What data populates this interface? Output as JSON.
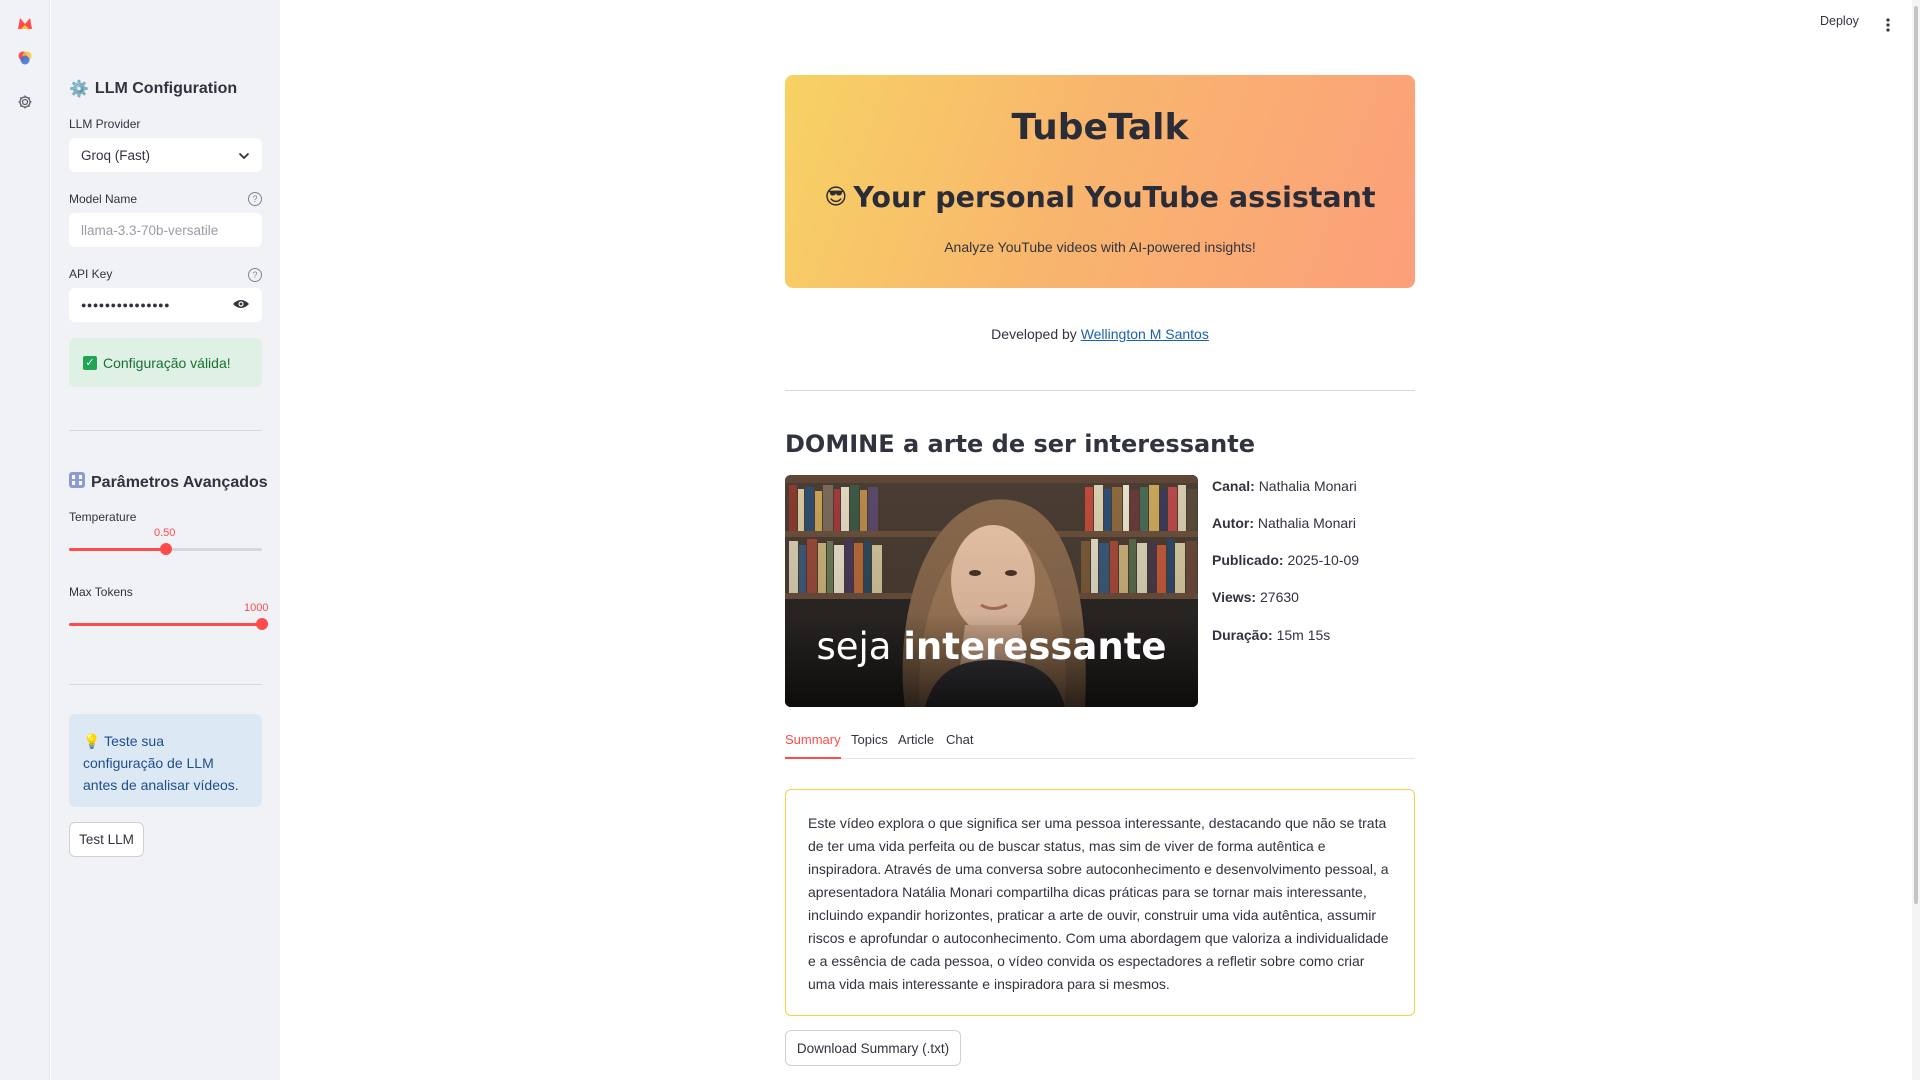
{
  "rail": {
    "icons": [
      "app-logo-icon",
      "palette-icon",
      "gear-icon"
    ]
  },
  "sidebar": {
    "llm_section_title": "LLM Configuration",
    "provider_label": "LLM Provider",
    "provider_value": "Groq (Fast)",
    "model_label": "Model Name",
    "model_placeholder": "llama-3.3-70b-versatile",
    "api_key_label": "API Key",
    "api_key_value": "●●●●●●●●●●●●●●●",
    "success_message": "Configuração válida!",
    "advanced_title": "Parâmetros Avançados",
    "temperature_label": "Temperature",
    "temperature_value": "0.50",
    "temperature_fraction": 0.5,
    "max_tokens_label": "Max Tokens",
    "max_tokens_value": "1000",
    "max_tokens_fraction": 1.0,
    "info_message": "Teste sua configuração de LLM antes de analisar vídeos.",
    "test_button": "Test LLM"
  },
  "header": {
    "deploy_label": "Deploy"
  },
  "hero": {
    "title": "TubeTalk",
    "subtitle": "Your personal YouTube assistant",
    "subtitle_emoji": "😎",
    "tagline": "Analyze YouTube videos with AI-powered insights!"
  },
  "developer": {
    "prefix": "Developed by",
    "name": "Wellington M Santos"
  },
  "video": {
    "title": "DOMINE a arte de ser interessante",
    "thumbnail_caption_light": "seja",
    "thumbnail_caption_bold": "interessante",
    "meta": [
      {
        "label": "Canal:",
        "value": "Nathalia Monari"
      },
      {
        "label": "Autor:",
        "value": "Nathalia Monari"
      },
      {
        "label": "Publicado:",
        "value": "2025-10-09"
      },
      {
        "label": "Views:",
        "value": "27630"
      },
      {
        "label": "Duração:",
        "value": "15m 15s"
      }
    ]
  },
  "tabs": [
    "Summary",
    "Topics",
    "Article",
    "Chat"
  ],
  "active_tab": "Summary",
  "summary": {
    "text": "Este vídeo explora o que significa ser uma pessoa interessante, destacando que não se trata de ter uma vida perfeita ou de buscar status, mas sim de viver de forma autêntica e inspiradora. Através de uma conversa sobre autoconhecimento e desenvolvimento pessoal, a apresentadora Natália Monari compartilha dicas práticas para se tornar mais interessante, incluindo expandir horizontes, praticar a arte de ouvir, construir uma vida autêntica, assumir riscos e aprofundar o autoconhecimento. Com uma abordagem que valoriza a individualidade e a essência de cada pessoa, o vídeo convida os espectadores a refletir sobre como criar uma vida mais interessante e inspiradora para si mesmos.",
    "download_button": "Download Summary (.txt)"
  },
  "colors": {
    "accent": "#ff4b4b",
    "sidebar_bg": "#f0f2f6",
    "success_bg": "#dff0e4",
    "info_bg": "#dde8f5",
    "summary_border": "#f2d24a"
  }
}
